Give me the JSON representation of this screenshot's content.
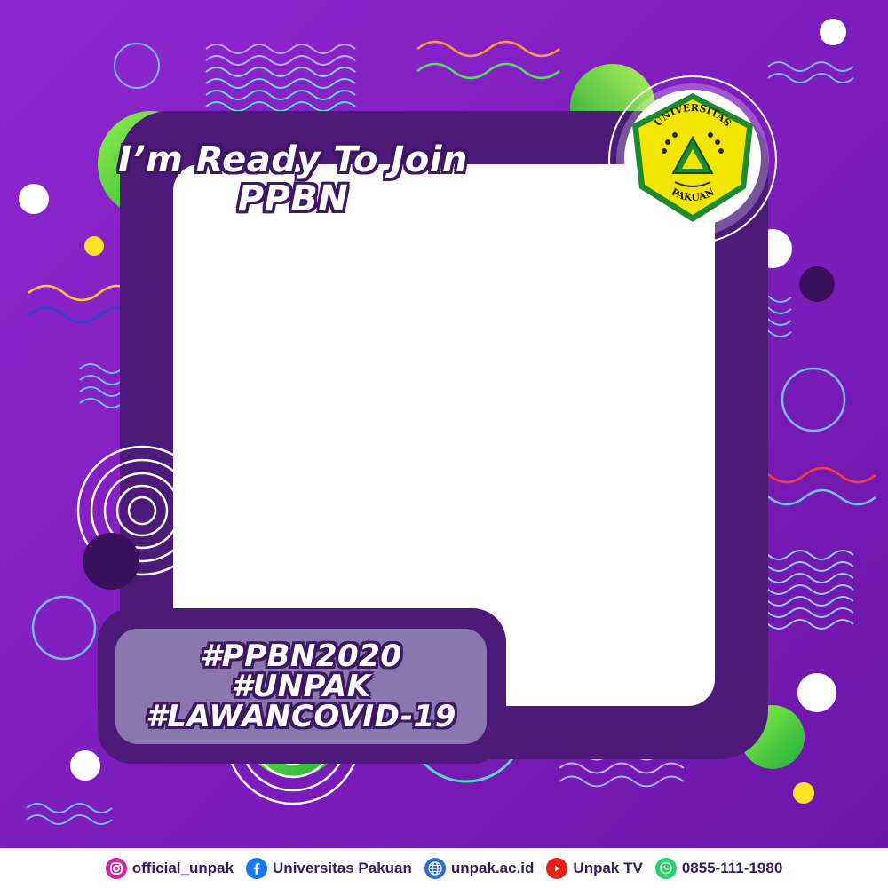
{
  "frame": {
    "headline": [
      "I’m Ready To Join",
      "PPBN"
    ],
    "hashtags": [
      "#PPBN2020",
      "#UNPAK",
      "#LAWANCOVID-19"
    ]
  },
  "logo": {
    "top_text": "UNIVERSITAS",
    "bottom_text": "PAKUAN"
  },
  "footer": {
    "items": [
      {
        "icon": "instagram-icon",
        "label": "official_unpak"
      },
      {
        "icon": "facebook-icon",
        "label": "Universitas Pakuan"
      },
      {
        "icon": "globe-icon",
        "label": "unpak.ac.id"
      },
      {
        "icon": "youtube-icon",
        "label": "Unpak TV"
      },
      {
        "icon": "whatsapp-icon",
        "label": "0855-111-1980"
      }
    ]
  },
  "colors": {
    "background": "#8a22c9",
    "frame": "#4d1a7a",
    "photo_area": "#ffffff",
    "accent_green": "#5bd43a",
    "logo_yellow": "#f2e600"
  }
}
